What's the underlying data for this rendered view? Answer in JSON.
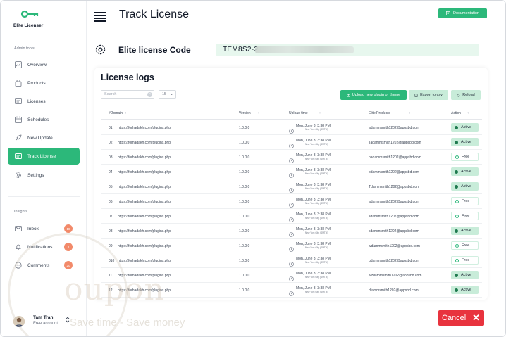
{
  "brand": {
    "name": "Elite Licenser"
  },
  "sidebar": {
    "admin_label": "Admin tools",
    "items": [
      {
        "label": "Overview",
        "icon": "chart-icon"
      },
      {
        "label": "Products",
        "icon": "bag-icon"
      },
      {
        "label": "Licenses",
        "icon": "license-icon"
      },
      {
        "label": "Schedules",
        "icon": "calendar-icon"
      },
      {
        "label": "New Update",
        "icon": "rocket-icon"
      },
      {
        "label": "Track License",
        "icon": "track-icon",
        "active": true
      },
      {
        "label": "Settings",
        "icon": "gear-icon"
      }
    ],
    "insights_label": "Insights",
    "insights": [
      {
        "label": "Inbox",
        "badge": "18"
      },
      {
        "label": "Notifications",
        "badge": "2"
      },
      {
        "label": "Comments",
        "badge": "20"
      }
    ]
  },
  "user": {
    "name": "Tam Tran",
    "plan": "Free account",
    "chevron": "⌃⌄"
  },
  "header": {
    "title": "Track License",
    "doc_button": "Documentation"
  },
  "license_code": {
    "label": "Elite license Code",
    "value": "TEM8S2-2"
  },
  "logs": {
    "title": "License logs",
    "search_placeholder": "Search",
    "per_page": "15",
    "upload_button": "Upload new plugin or theme",
    "export_button": "Export to csv",
    "reload_button": "Reload",
    "columns": [
      "#Domain",
      "Version",
      "Upload time",
      "Elite Products",
      "Action"
    ],
    "rows": [
      {
        "num": "01",
        "domain": "https://forhadakh.com/plugins.php",
        "version": "1.0.0.0",
        "time": "Mon, June 8, 3:38 PM",
        "tz": "New York City (GMT-4)",
        "product": "adammsmith1202@appsbd.com",
        "status": "Active"
      },
      {
        "num": "02",
        "domain": "https://forhadakh.com/plugins.php",
        "version": "1.0.0.0",
        "time": "Mon, June 8, 3:38 PM",
        "tz": "New York City (GMT-4)",
        "product": "Tadammsmith1202@appsbd.com",
        "status": "Active"
      },
      {
        "num": "03",
        "domain": "https://forhadakh.com/plugins.php",
        "version": "1.0.0.0",
        "time": "Mon, June 8, 3:38 PM",
        "tz": "New York City (GMT-4)",
        "product": "nadammsmith1202@appsbd.com",
        "status": "Free"
      },
      {
        "num": "04",
        "domain": "https://forhadakh.com/plugins.php",
        "version": "1.0.0.0",
        "time": "Mon, June 8, 3:38 PM",
        "tz": "New York City (GMT-4)",
        "product": "pdammsmith1202@appsbd.com",
        "status": "Active"
      },
      {
        "num": "05",
        "domain": "https://forhadakh.com/plugins.php",
        "version": "1.0.0.0",
        "time": "Mon, June 8, 3:38 PM",
        "tz": "New York City (GMT-4)",
        "product": "Tdammsmith1202@appsbd.com",
        "status": "Active"
      },
      {
        "num": "06",
        "domain": "https://forhadakh.com/plugins.php",
        "version": "1.0.0.0",
        "time": "Mon, June 8, 3:38 PM",
        "tz": "New York City (GMT-4)",
        "product": "adammsmith1202@appsbd.com",
        "status": "Free"
      },
      {
        "num": "07",
        "domain": "https://forhadakh.com/plugins.php",
        "version": "1.0.0.0",
        "time": "Mon, June 8, 3:38 PM",
        "tz": "New York City (GMT-4)",
        "product": "sdammsmith1202@appsbd.com",
        "status": "Free"
      },
      {
        "num": "08",
        "domain": "https://forhadakh.com/plugins.php",
        "version": "1.0.0.0",
        "time": "Mon, June 8, 3:38 PM",
        "tz": "New York City (GMT-4)",
        "product": "sdammsmith1202@appsbd.com",
        "status": "Active"
      },
      {
        "num": "09",
        "domain": "https://forhadakh.com/plugins.php",
        "version": "1.0.0.0",
        "time": "Mon, June 8, 3:38 PM",
        "tz": "New York City (GMT-4)",
        "product": "wdammsmith1202@appsbd.com",
        "status": "Free"
      },
      {
        "num": "010",
        "domain": "https://forhadakh.com/plugins.php",
        "version": "1.0.0.0",
        "time": "Mon, June 8, 3:38 PM",
        "tz": "New York City (GMT-4)",
        "product": "qdammsmith1202@appsbd.com",
        "status": "Free"
      },
      {
        "num": "11",
        "domain": "https://forhadakh.com/plugins.php",
        "version": "1.0.0.0",
        "time": "Mon, June 8, 3:38 PM",
        "tz": "New York City (GMT-4)",
        "product": "wzdammsmith1202@appsbd.com",
        "status": "Active"
      },
      {
        "num": "12",
        "domain": "https://forhadakh.com/plugins.php",
        "version": "1.0.0.0",
        "time": "Mon, June 8, 3:38 PM",
        "tz": "New York City (GMT-4)",
        "product": "dfammsmith1202@appsbd.com",
        "status": "Active"
      }
    ]
  },
  "cancel": {
    "label": "Cancel",
    "icon": "close-icon"
  },
  "watermark": {
    "word": "oupon",
    "tagline": "Save time - Save money"
  },
  "colors": {
    "accent": "#2cb87a",
    "accent_light": "#c8ecd9",
    "danger": "#e8333e",
    "badge": "#f28a6a"
  }
}
